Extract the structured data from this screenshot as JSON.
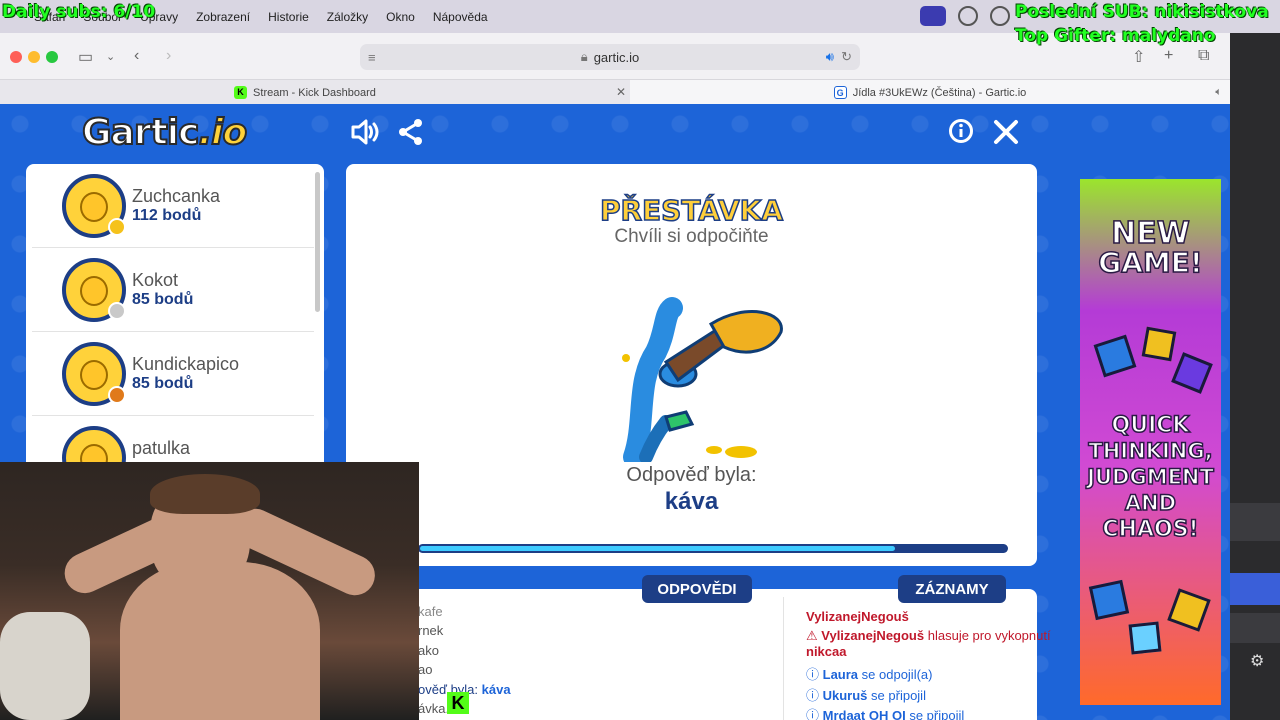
{
  "overlay": {
    "daily_subs": "Daily subs: 6/10",
    "last_sub": "Poslední SUB: nikisistkova",
    "top_gifter": "Top Gifter: malydano"
  },
  "menubar": {
    "items": [
      "Safari",
      "Soubor",
      "Úpravy",
      "Zobrazení",
      "Historie",
      "Záložky",
      "Okno",
      "Nápověda"
    ]
  },
  "browser": {
    "url": "gartic.io",
    "tabs": [
      {
        "title": "Stream - Kick Dashboard",
        "favicon": "K"
      },
      {
        "title": "Jídla #3UkEWz (Čeština) - Gartic.io",
        "favicon": "G"
      }
    ]
  },
  "game": {
    "logo_main": "Gartic",
    "logo_suffix": ".io",
    "players": [
      {
        "name": "Zuchcanka",
        "points": "112 bodů",
        "badge_color": "#f5c21b"
      },
      {
        "name": "Kokot",
        "points": "85 bodů",
        "badge_color": "#c9c9c9"
      },
      {
        "name": "Kundickapico",
        "points": "85 bodů",
        "badge_color": "#e07a1b"
      },
      {
        "name": "patulka",
        "points": "",
        "badge_color": ""
      }
    ],
    "board": {
      "title": "PŘESTÁVKA",
      "subtitle": "Chvíli si odpočiňte",
      "answer_label": "Odpověď byla:",
      "answer": "káva",
      "progress": 0.81
    },
    "chat": {
      "answers_tab": "ODPOVĚDI",
      "records_tab": "ZÁZNAMY",
      "answers": [
        "kafe",
        "rnek",
        "ako",
        "ao"
      ],
      "answer_reveal_prefix": "ověď byla:",
      "answer_reveal_word": "káva",
      "last_answer": "ávka...",
      "log": [
        {
          "icon": "warning",
          "user": "VylizanejNegouš",
          "text": ""
        },
        {
          "icon": "warning",
          "user": "VylizanejNegouš",
          "text": "hlasuje pro vykopnutí",
          "target": "nikcaa"
        },
        {
          "icon": "info",
          "user": "Laura",
          "text": "se odpojil(a)"
        },
        {
          "icon": "info",
          "user": "Ukuruš",
          "text": "se připojil"
        },
        {
          "icon": "info",
          "user": "Mrdaat OH OI",
          "text": "se připojil"
        }
      ]
    }
  },
  "ad": {
    "line1": "NEW",
    "line2": "GAME!",
    "line3": "QUICK",
    "line4": "THINKING,",
    "line5": "JUDGMENT",
    "line6": "AND",
    "line7": "CHAOS!"
  },
  "colors": {
    "page_blue": "#1d64d8",
    "navy": "#1d3e86",
    "yellow": "#ffd23a",
    "kick_green": "#53fc18",
    "warning_red": "#c0182b"
  }
}
